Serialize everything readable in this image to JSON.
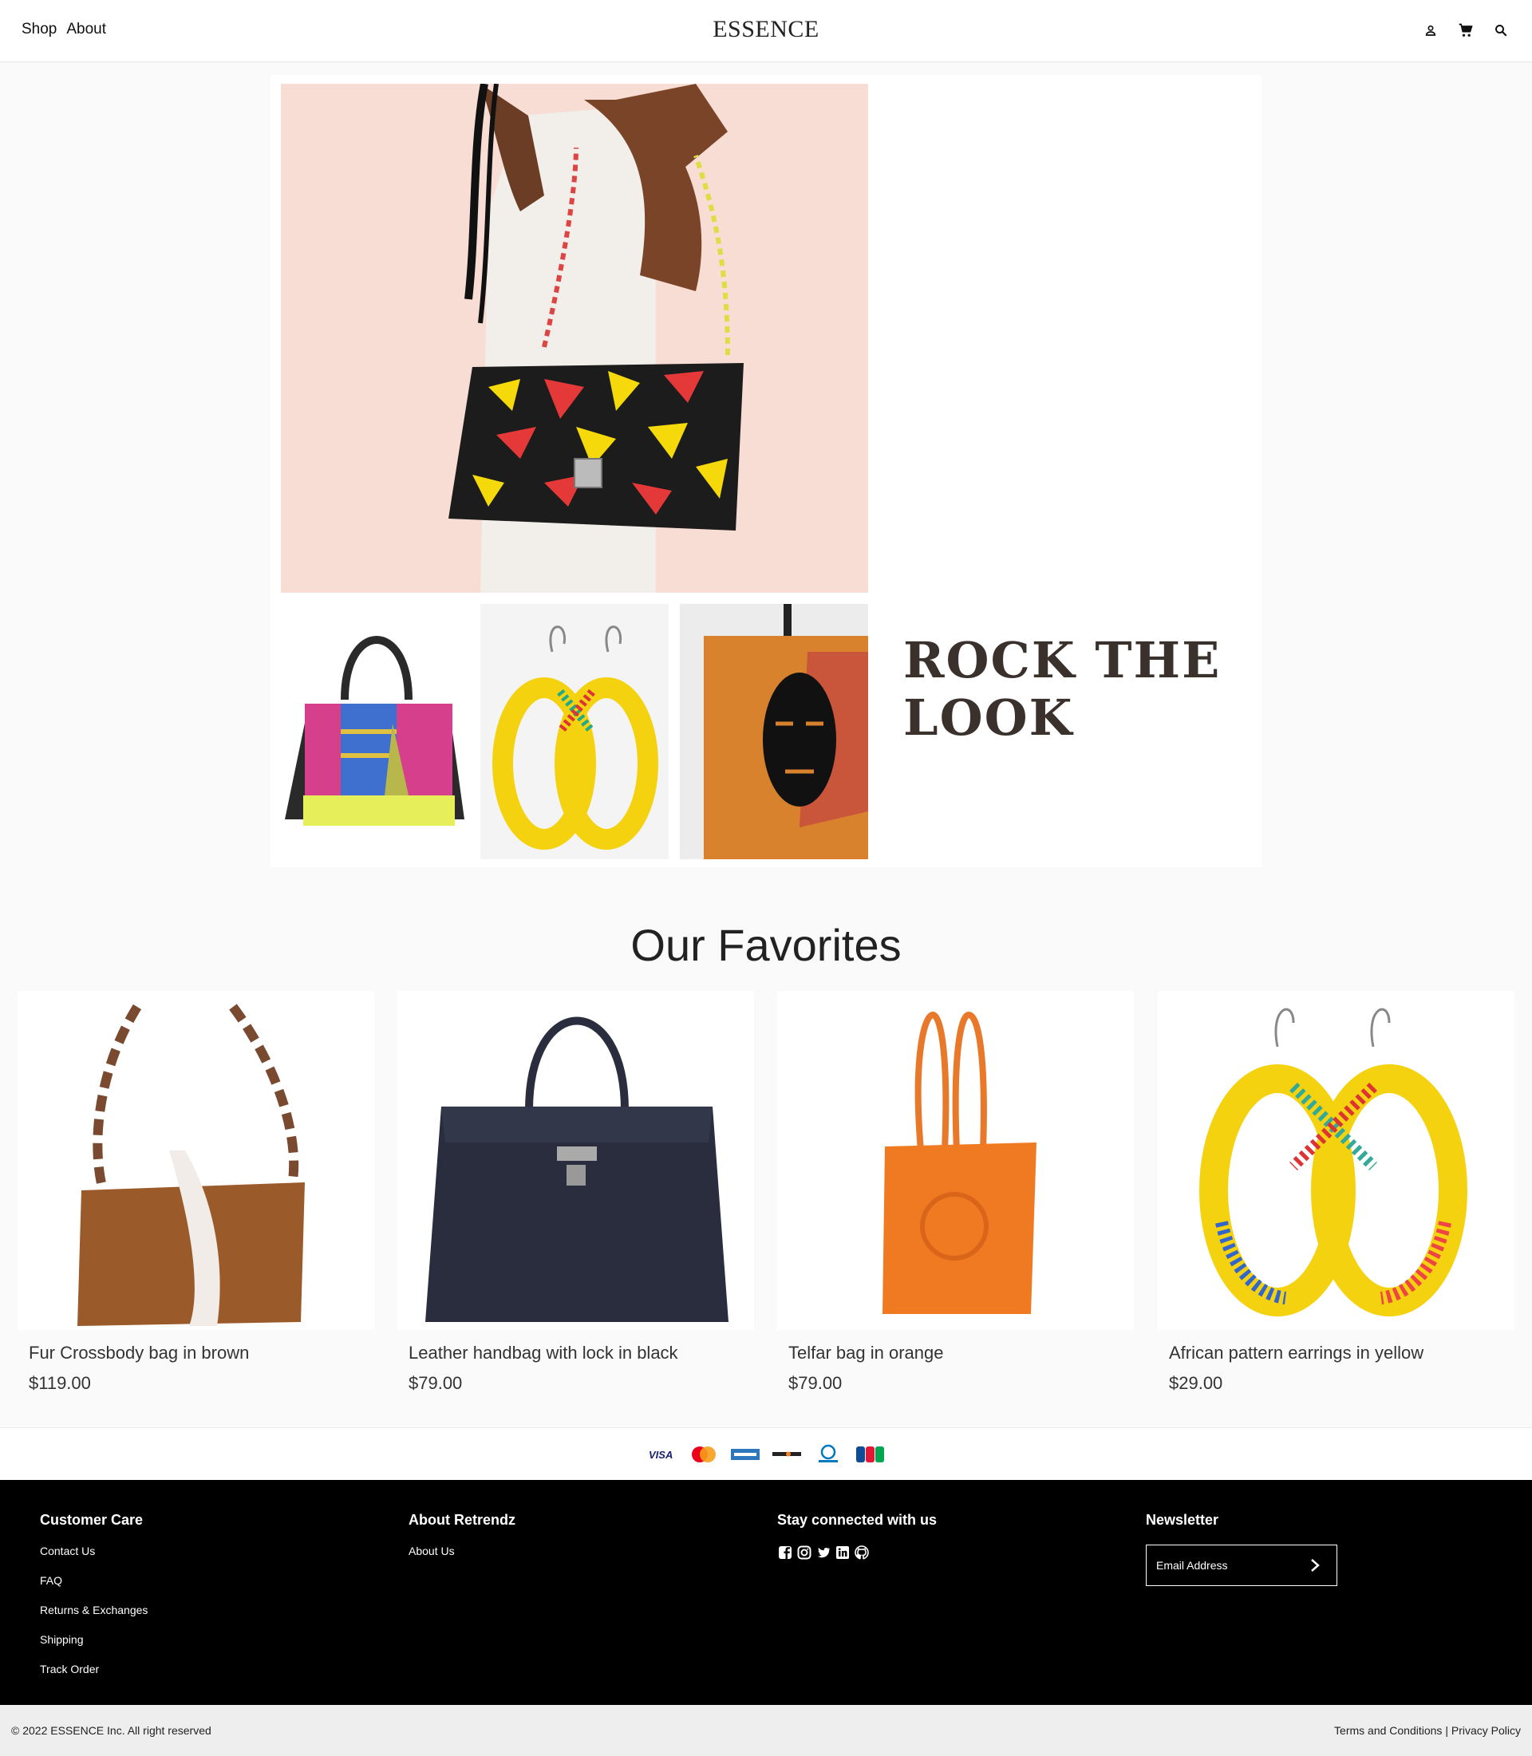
{
  "header": {
    "nav": [
      "Shop",
      "About"
    ],
    "logo": "ESSENCE",
    "icons": [
      "account-icon",
      "cart-icon",
      "search-icon"
    ]
  },
  "hero": {
    "title": "ROCK THE LOOK"
  },
  "favorites": {
    "title": "Our Favorites",
    "products": [
      {
        "name": "Fur Crossbody bag in brown",
        "price": "$119.00"
      },
      {
        "name": "Leather handbag with lock in black",
        "price": "$79.00"
      },
      {
        "name": "Telfar bag in orange",
        "price": "$79.00"
      },
      {
        "name": "African pattern earrings in yellow",
        "price": "$29.00"
      }
    ]
  },
  "payments": [
    "VISA",
    "MasterCard",
    "American Express",
    "DISCOVER",
    "Diners Club",
    "JCB"
  ],
  "footer": {
    "customer_care": {
      "title": "Customer Care",
      "links": [
        "Contact Us",
        "FAQ",
        "Returns & Exchanges",
        "Shipping",
        "Track Order"
      ]
    },
    "about": {
      "title": "About Retrendz",
      "links": [
        "About Us"
      ]
    },
    "social": {
      "title": "Stay connected with us",
      "icons": [
        "facebook-icon",
        "instagram-icon",
        "twitter-icon",
        "linkedin-icon",
        "github-icon"
      ]
    },
    "newsletter": {
      "title": "Newsletter",
      "placeholder": "Email Address"
    }
  },
  "bottom": {
    "copyright": "© 2022 ESSENCE Inc. All right reserved",
    "terms": "Terms and Conditions",
    "separator": "|",
    "privacy": "Privacy Policy"
  },
  "colors": {
    "hero_title": "#3a312c",
    "footer_bg": "#000000",
    "bottom_bg": "#eeeeee"
  }
}
